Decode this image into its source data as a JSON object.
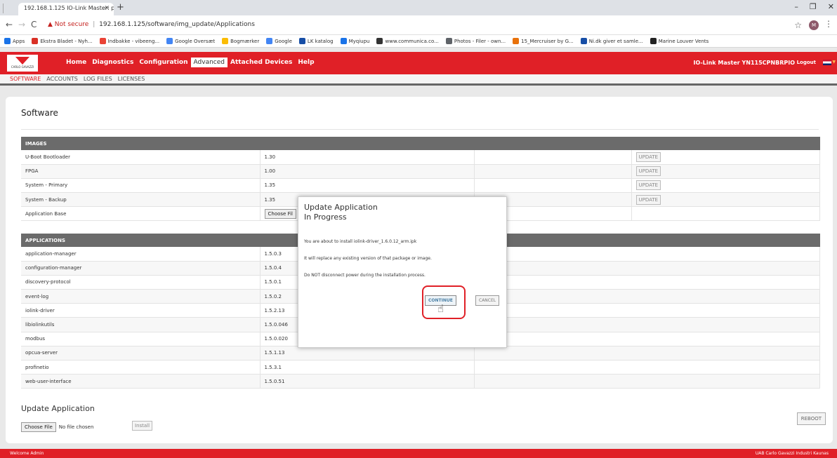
{
  "browser": {
    "tab_title": "192.168.1.125 IO-Link Master: pa",
    "url_secure": "Not secure",
    "url": "192.168.1.125/software/img_update/Applications",
    "bookmarks": [
      "Apps",
      "Ekstra Bladet - Nyh...",
      "Indbakke - vibeeng...",
      "Google Oversæt",
      "Bogmærker",
      "Google",
      "LK katalog",
      "Myqiupu",
      "www.communica.co...",
      "Photos - Filer - own...",
      "15_Mercruiser by G...",
      "Ni.dk giver et samle...",
      "Marine Louver Vents"
    ],
    "bookmark_colors": [
      "#1a73e8",
      "#d93025",
      "#ea4335",
      "#4285f4",
      "#fbbc04",
      "#4285f4",
      "#174ea6",
      "#1a73e8",
      "#333333",
      "#5f6368",
      "#e8710a",
      "#174ea6",
      "#222222"
    ],
    "profile_initial": "M"
  },
  "header": {
    "logo_text": "CARLO GAVAZZI",
    "nav": [
      "Home",
      "Diagnostics",
      "Configuration",
      "Advanced",
      "Attached Devices",
      "Help"
    ],
    "active_nav": "Advanced",
    "device_name": "IO-Link Master YN115CPNBRPIO",
    "logout": "Logout"
  },
  "subnav": [
    "SOFTWARE",
    "ACCOUNTS",
    "LOG FILES",
    "LICENSES"
  ],
  "page": {
    "title": "Software",
    "images_header": "IMAGES",
    "images": [
      {
        "name": "U-Boot Bootloader",
        "version": "1.30",
        "action": "UPDATE"
      },
      {
        "name": "FPGA",
        "version": "1.00",
        "action": "UPDATE"
      },
      {
        "name": "System - Primary",
        "version": "1.35",
        "action": "UPDATE"
      },
      {
        "name": "System - Backup",
        "version": "1.35",
        "action": "UPDATE"
      },
      {
        "name": "Application Base",
        "version": "Choose Fil",
        "action": ""
      }
    ],
    "applications_header": "APPLICATIONS",
    "applications": [
      {
        "name": "application-manager",
        "version": "1.5.0.3"
      },
      {
        "name": "configuration-manager",
        "version": "1.5.0.4"
      },
      {
        "name": "discovery-protocol",
        "version": "1.5.0.1"
      },
      {
        "name": "event-log",
        "version": "1.5.0.2"
      },
      {
        "name": "iolink-driver",
        "version": "1.5.2.13"
      },
      {
        "name": "libiolinkutils",
        "version": "1.5.0.046"
      },
      {
        "name": "modbus",
        "version": "1.5.0.020"
      },
      {
        "name": "opcua-server",
        "version": "1.5.1.13"
      },
      {
        "name": "profinetio",
        "version": "1.5.3.1"
      },
      {
        "name": "web-user-interface",
        "version": "1.5.0.51"
      }
    ],
    "update_title": "Update Application",
    "choose_file": "Choose File",
    "no_file": "No file chosen",
    "install": "Install",
    "reboot": "REBOOT"
  },
  "modal": {
    "title": "Update Application",
    "subtitle": "In Progress",
    "line1": "You are about to install iolink-driver_1.6.0.12_arm.ipk",
    "line2": "It will replace any existing version of that package or image.",
    "line3": "Do NOT disconnect power during the installation process.",
    "continue": "CONTINUE",
    "cancel": "CANCEL"
  },
  "footer": {
    "left": "Welcome Admin",
    "right": "UAB Carlo Gavazzi Industri Kaunas"
  }
}
